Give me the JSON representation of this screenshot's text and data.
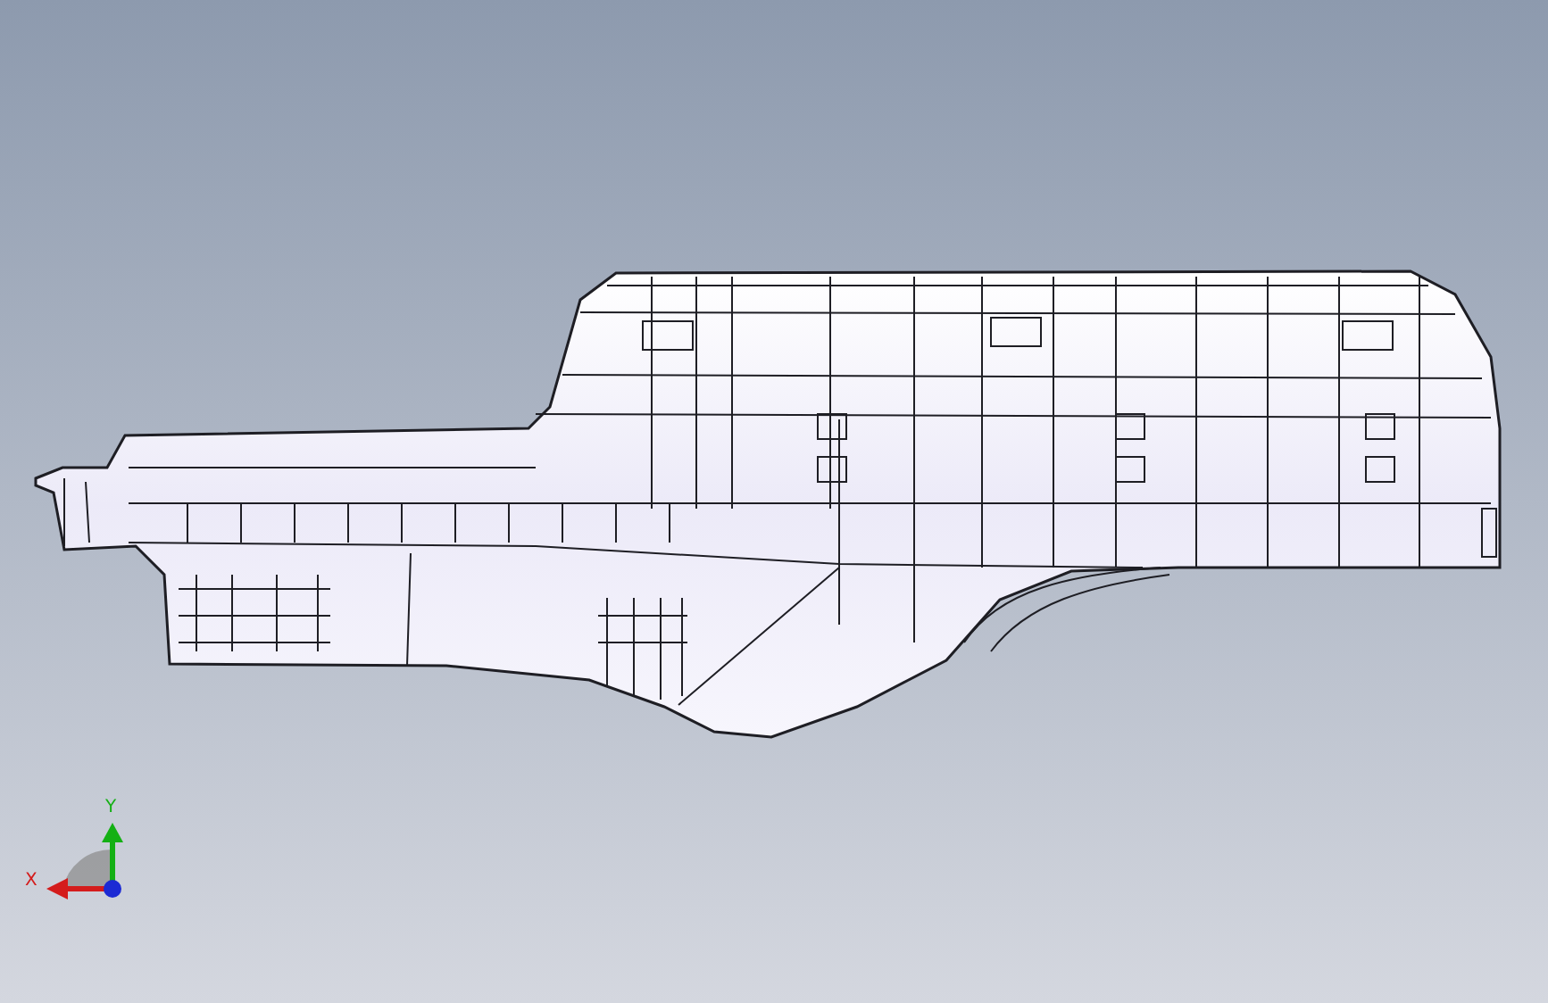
{
  "triad": {
    "x_label": "X",
    "y_label": "Y"
  }
}
